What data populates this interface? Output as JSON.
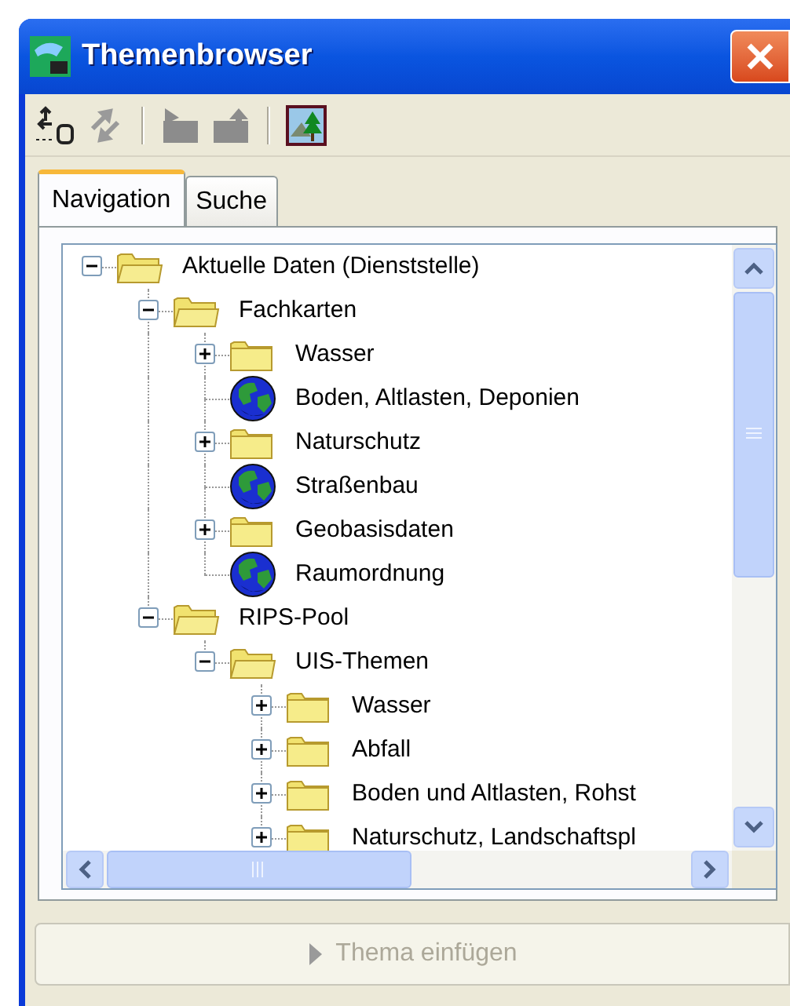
{
  "window": {
    "title": "Themenbrowser"
  },
  "toolbar": [
    {
      "kind": "sync-db",
      "disabled": false
    },
    {
      "kind": "sync",
      "disabled": true
    },
    {
      "kind": "separator"
    },
    {
      "kind": "folder-in",
      "disabled": true
    },
    {
      "kind": "folder-out",
      "disabled": true
    },
    {
      "kind": "separator"
    },
    {
      "kind": "picture",
      "disabled": false
    }
  ],
  "tabs": [
    {
      "label": "Navigation",
      "selected": true
    },
    {
      "label": "Suche",
      "selected": false
    }
  ],
  "tree": [
    {
      "label": "Aktuelle Daten (Dienststelle)",
      "kind": "folder",
      "expanded": true,
      "children": [
        {
          "label": "Fachkarten",
          "kind": "folder",
          "expanded": true,
          "children": [
            {
              "label": "Wasser",
              "kind": "folder",
              "expanded": false
            },
            {
              "label": "Boden, Altlasten, Deponien",
              "kind": "globe"
            },
            {
              "label": "Naturschutz",
              "kind": "folder",
              "expanded": false
            },
            {
              "label": "Straßenbau",
              "kind": "globe"
            },
            {
              "label": "Geobasisdaten",
              "kind": "folder",
              "expanded": false
            },
            {
              "label": "Raumordnung",
              "kind": "globe"
            }
          ]
        },
        {
          "label": "RIPS-Pool",
          "kind": "folder",
          "expanded": true,
          "children": [
            {
              "label": "UIS-Themen",
              "kind": "folder",
              "expanded": true,
              "children": [
                {
                  "label": "Wasser",
                  "kind": "folder",
                  "expanded": false
                },
                {
                  "label": "Abfall",
                  "kind": "folder",
                  "expanded": false
                },
                {
                  "label": "Boden und Altlasten, Rohst",
                  "kind": "folder",
                  "expanded": false
                },
                {
                  "label": "Naturschutz, Landschaftspl",
                  "kind": "folder",
                  "expanded": false
                }
              ]
            }
          ]
        }
      ]
    }
  ],
  "insert_button": {
    "label": "Thema einfügen",
    "disabled": true
  }
}
